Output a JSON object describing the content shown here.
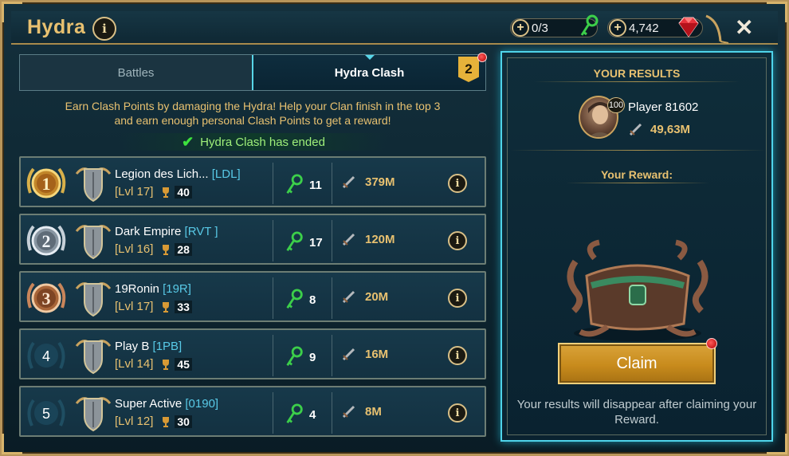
{
  "header": {
    "title": "Hydra",
    "keys_value": "0/3",
    "gems_value": "4,742"
  },
  "tabs": {
    "battles_label": "Battles",
    "clash_label": "Hydra Clash",
    "clash_badge": "2"
  },
  "description": {
    "line1": "Earn Clash Points by damaging the Hydra! Help your Clan finish in the top 3",
    "line2": "and earn enough personal Clash Points to get a reward!"
  },
  "status": {
    "text": "Hydra Clash has ended"
  },
  "clans": [
    {
      "rank": "1",
      "name": "Legion des Lich...",
      "tag": "[LDL]",
      "level": "[Lvl 17]",
      "trophies": "40",
      "keys": "11",
      "damage": "379M"
    },
    {
      "rank": "2",
      "name": "Dark Empire",
      "tag": "[RVT ]",
      "level": "[Lvl 16]",
      "trophies": "28",
      "keys": "17",
      "damage": "120M"
    },
    {
      "rank": "3",
      "name": "19Ronin",
      "tag": "[19R]",
      "level": "[Lvl 17]",
      "trophies": "33",
      "keys": "8",
      "damage": "20M"
    },
    {
      "rank": "4",
      "name": "Play B",
      "tag": "[1PB]",
      "level": "[Lvl 14]",
      "trophies": "45",
      "keys": "9",
      "damage": "16M"
    },
    {
      "rank": "5",
      "name": "Super Active",
      "tag": "[0190]",
      "level": "[Lvl 12]",
      "trophies": "30",
      "keys": "4",
      "damage": "8M"
    }
  ],
  "results": {
    "heading": "YOUR RESULTS",
    "player_level": "100",
    "player_name": "Player 81602",
    "player_damage": "49,63M",
    "reward_heading": "Your Reward:",
    "claim_label": "Claim",
    "note": "Your results will disappear after claiming your Reward."
  },
  "colors": {
    "accent_gold": "#e8c170",
    "tag_blue": "#58c9e6",
    "key_green": "#3ccf4a",
    "panel_border": "#4fd4ea"
  }
}
